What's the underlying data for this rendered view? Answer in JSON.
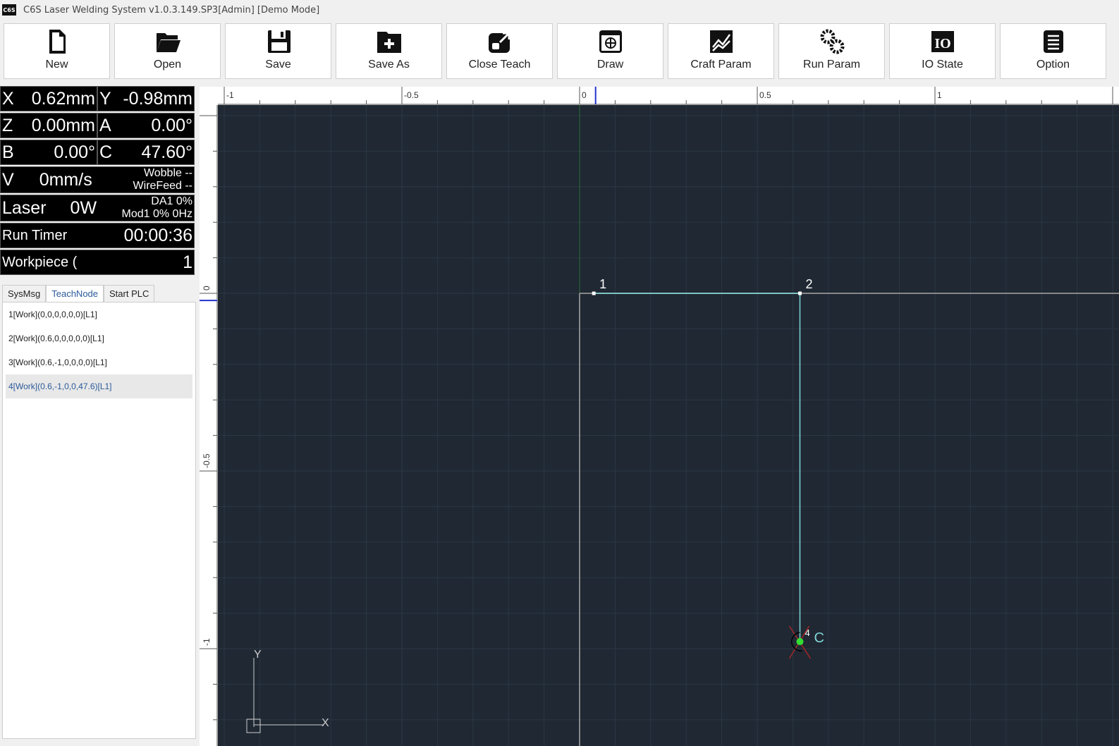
{
  "title": "C6S Laser Welding System v1.0.3.149.SP3[Admin] [Demo Mode]",
  "logo": "C6S",
  "toolbar": [
    {
      "label": "New",
      "icon": "file-icon"
    },
    {
      "label": "Open",
      "icon": "folder-open-icon"
    },
    {
      "label": "Save",
      "icon": "save-icon"
    },
    {
      "label": "Save As",
      "icon": "folder-plus-icon"
    },
    {
      "label": "Close Teach",
      "icon": "external-link-icon"
    },
    {
      "label": "Draw",
      "icon": "draw-icon"
    },
    {
      "label": "Craft Param",
      "icon": "chart-icon"
    },
    {
      "label": "Run Param",
      "icon": "gears-icon"
    },
    {
      "label": "IO State",
      "icon": "io-icon"
    },
    {
      "label": "Option",
      "icon": "list-icon"
    }
  ],
  "status": {
    "x_label": "X",
    "x": "0.62mm",
    "y_label": "Y",
    "y": "-0.98mm",
    "z_label": "Z",
    "z": "0.00mm",
    "a_label": "A",
    "a": "0.00°",
    "b_label": "B",
    "b": "0.00°",
    "c_label": "C",
    "c": "47.60°",
    "v_label": "V",
    "v": "0mm/s",
    "wobble": "Wobble --",
    "wirefeed": "WireFeed --",
    "laser_label": "Laser",
    "laser": "0W",
    "da1": "DA1  0%",
    "mod1": "Mod1 0% 0Hz",
    "timer_label": "Run Timer",
    "timer": "00:00:36",
    "workpiece_label": "Workpiece (",
    "workpiece": "1"
  },
  "tabs": [
    {
      "label": "SysMsg"
    },
    {
      "label": "TeachNode",
      "active": true
    },
    {
      "label": "Start PLC"
    }
  ],
  "nodes": [
    "1[Work](0,0,0,0,0,0)[L1]",
    "2[Work](0.6,0,0,0,0,0)[L1]",
    "3[Work](0.6,-1,0,0,0,0)[L1]",
    "4[Work](0.6,-1,0,0,47.6)[L1]"
  ],
  "selected_node": 3,
  "canvas": {
    "x_ticks": [
      {
        "v": -1,
        "t": "-1"
      },
      {
        "v": -0.5,
        "t": "-0.5"
      },
      {
        "v": 0,
        "t": "0"
      },
      {
        "v": 0.5,
        "t": "0.5"
      },
      {
        "v": 1,
        "t": "1"
      }
    ],
    "y_ticks": [
      {
        "v": 0,
        "t": "0"
      },
      {
        "v": -0.5,
        "t": "-0.5"
      },
      {
        "v": -1,
        "t": "-1"
      }
    ],
    "points": [
      {
        "label": "1",
        "x": 0.04,
        "y": 0
      },
      {
        "label": "2",
        "x": 0.62,
        "y": 0
      },
      {
        "label": "4",
        "x": 0.62,
        "y": -0.98
      }
    ],
    "current_label": "C",
    "axis_x": "X",
    "axis_y": "Y",
    "colors": {
      "background": "#1f2833",
      "grid": "#2c3744",
      "path": "#7fd6d6",
      "current": "#33dd33"
    }
  }
}
